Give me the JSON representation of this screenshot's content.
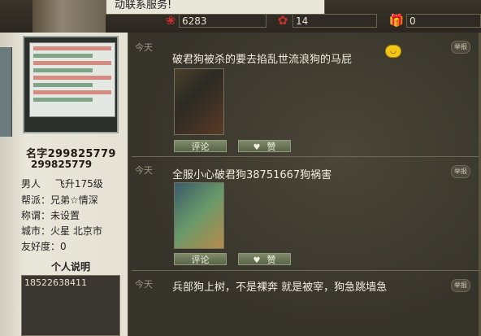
{
  "top": {
    "message": "动联系服务!",
    "stat1": "6283",
    "stat2": "14",
    "stat3": "0"
  },
  "profile": {
    "name_label": "名字",
    "name_value": "299825779",
    "uid": "299825779",
    "gender": "男人",
    "level": "飞升175级",
    "guild": "帮派：兄弟☆情深",
    "title": "称谓：未设置",
    "city": "城市：火星 北京市",
    "friendship": "友好度：0",
    "about_heading": "个人说明",
    "about_text": "18522638411"
  },
  "posts": [
    {
      "time": "今天",
      "report": "举报",
      "text": "破君狗被杀的要去掐乱世流浪狗的马屁",
      "comment": "评论",
      "like": "赞"
    },
    {
      "time": "今天",
      "report": "举报",
      "text": "全服小心破君狗38751667狗祸害",
      "comment": "评论",
      "like": "赞"
    },
    {
      "time": "今天",
      "report": "举报",
      "text": "兵部狗上树，不是裸奔 就是被宰，狗急跳墙急"
    }
  ]
}
